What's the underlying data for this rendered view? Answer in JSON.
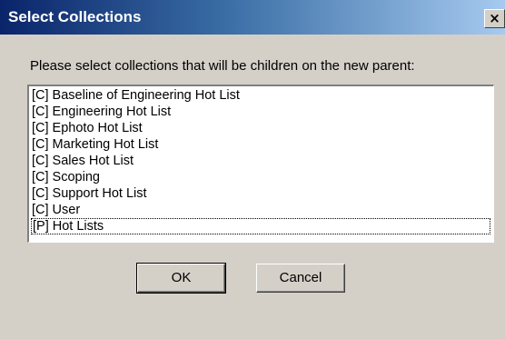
{
  "window": {
    "title": "Select Collections",
    "close_glyph": "×"
  },
  "prompt": "Please select collections that will be children on the new parent:",
  "collections": [
    "[C] Baseline of Engineering Hot List",
    "[C] Engineering Hot List",
    "[C] Ephoto Hot List",
    "[C] Marketing Hot List",
    "[C] Sales Hot List",
    "[C] Scoping",
    "[C] Support Hot List",
    "[C] User",
    "[P] Hot Lists"
  ],
  "buttons": {
    "ok": "OK",
    "cancel": "Cancel"
  },
  "colors": {
    "titlebar_start": "#0a246a",
    "titlebar_end": "#a6caf0",
    "face": "#d4d0c8"
  }
}
